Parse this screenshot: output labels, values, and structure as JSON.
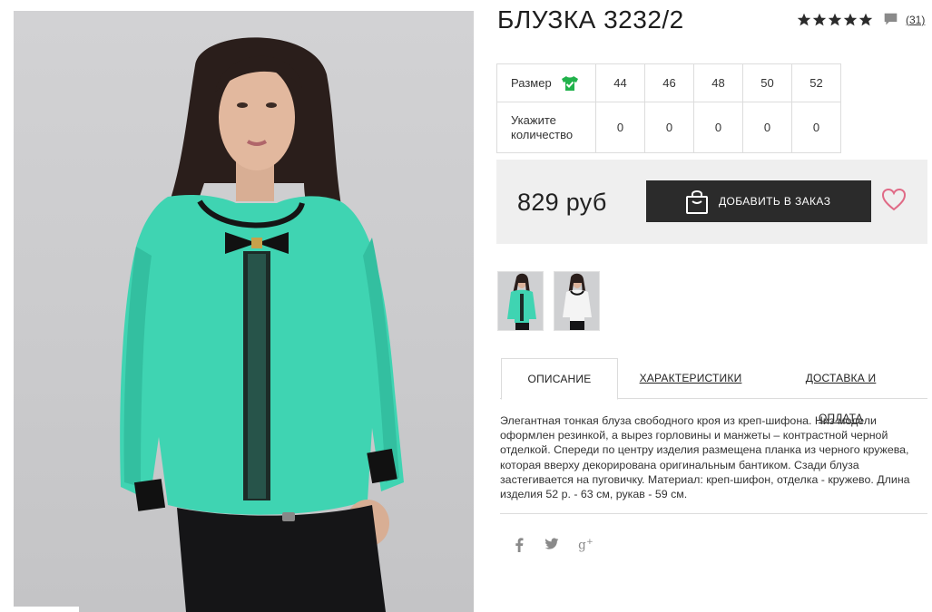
{
  "product": {
    "title": "БЛУЗКА 3232/2",
    "rating": {
      "stars": 5,
      "review_count": "(31)"
    }
  },
  "sizes": {
    "size_label": "Размер",
    "quantity_label_line1": "Укажите",
    "quantity_label_line2": "количество",
    "items": [
      {
        "size": "44",
        "qty": "0"
      },
      {
        "size": "46",
        "qty": "0"
      },
      {
        "size": "48",
        "qty": "0"
      },
      {
        "size": "50",
        "qty": "0"
      },
      {
        "size": "52",
        "qty": "0"
      }
    ]
  },
  "buy": {
    "price": "829 руб",
    "add_button": "ДОБАВИТЬ В ЗАКАЗ"
  },
  "tabs": [
    {
      "label": "ОПИСАНИЕ",
      "active": true
    },
    {
      "label": "ХАРАКТЕРИСТИКИ",
      "active": false
    },
    {
      "label": "ДОСТАВКА И ОПЛАТА",
      "active": false
    }
  ],
  "description": "Элегантная тонкая блуза свободного кроя из креп-шифона. Низ модели оформлен резинкой, а вырез горловины и манжеты – контрастной черной отделкой. Спереди по центру изделия размещена планка из черного кружева, которая вверху декорирована оригинальным бантиком. Сзади блуза застегивается на пуговичку. Материал: креп-шифон, отделка - кружево. Длина изделия 52 р. - 63 см, рукав - 59 см.",
  "icons": {
    "star": "star-icon",
    "comment": "comment-icon",
    "size_guide": "tshirt-check-icon",
    "bag": "shopping-bag-icon",
    "wishlist": "heart-icon",
    "facebook": "facebook-icon",
    "twitter": "twitter-icon",
    "google_plus": "google-plus-icon"
  },
  "colors": {
    "accent_green": "#21b24b",
    "button_dark": "#2b2b2b",
    "heart_pink": "#e06a86",
    "panel_bg": "#efefef",
    "blouse_mint": "#3fd4b2"
  }
}
